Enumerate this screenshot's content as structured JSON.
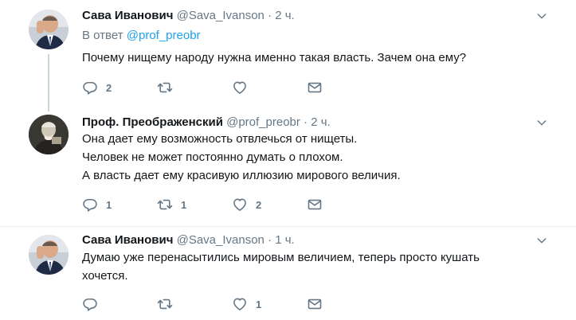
{
  "tweets": [
    {
      "name": "Сава Иванович",
      "handle": "@Sava_Ivanson",
      "dot": "·",
      "time": "2 ч.",
      "reply_prefix": "В ответ",
      "reply_mention": "@prof_preobr",
      "lines": [
        "Почему нищему народу нужна именно такая власть. Зачем она ему?"
      ],
      "reply_count": "2",
      "retweet_count": "",
      "like_count": ""
    },
    {
      "name": "Проф. Преображенский",
      "handle": "@prof_preobr",
      "dot": "·",
      "time": "2 ч.",
      "lines": [
        "Она дает ему возможность отвлечься от нищеты.",
        "Человек не может постоянно думать о плохом.",
        "А власть дает ему красивую иллюзию мирового величия."
      ],
      "reply_count": "1",
      "retweet_count": "1",
      "like_count": "2"
    },
    {
      "name": "Сава Иванович",
      "handle": "@Sava_Ivanson",
      "dot": "·",
      "time": "1 ч.",
      "lines": [
        "Думаю уже перенасытились мировым величием, теперь просто кушать",
        "хочется."
      ],
      "reply_count": "",
      "retweet_count": "",
      "like_count": "1"
    }
  ],
  "icons": {
    "reply": "reply-icon",
    "retweet": "retweet-icon",
    "like": "heart-icon",
    "message": "envelope-icon",
    "caret": "chevron-down-icon"
  },
  "colors": {
    "link": "#1da1f2",
    "muted": "#657786",
    "thread_line": "#ccd6dd",
    "divider": "#e6ecf0"
  }
}
